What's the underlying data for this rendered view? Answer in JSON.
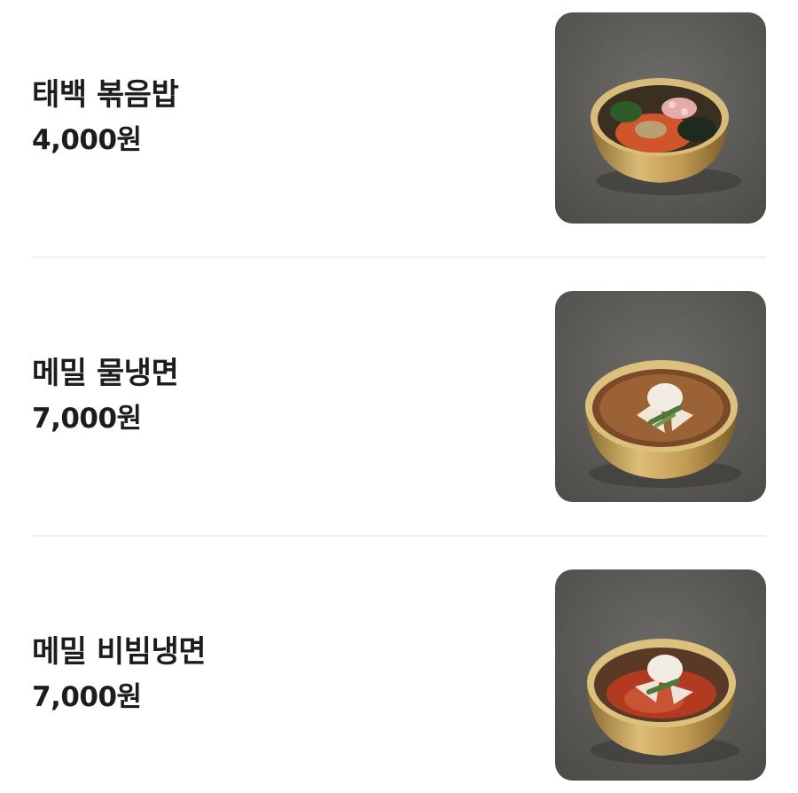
{
  "menu": {
    "items": [
      {
        "name": "태백 볶음밥",
        "price": "4,000원",
        "photo": "fried-rice-bowl"
      },
      {
        "name": "메밀 물냉면",
        "price": "7,000원",
        "photo": "cold-buckwheat-noodle-soup"
      },
      {
        "name": "메밀 비빔냉면",
        "price": "7,000원",
        "photo": "spicy-buckwheat-noodles"
      }
    ]
  },
  "colors": {
    "background": "#ffffff",
    "text": "#1d1d1d",
    "divider": "#f0f0f0",
    "photo_backdrop": "#5e5d59",
    "brass_bowl": "#c8a45a"
  }
}
